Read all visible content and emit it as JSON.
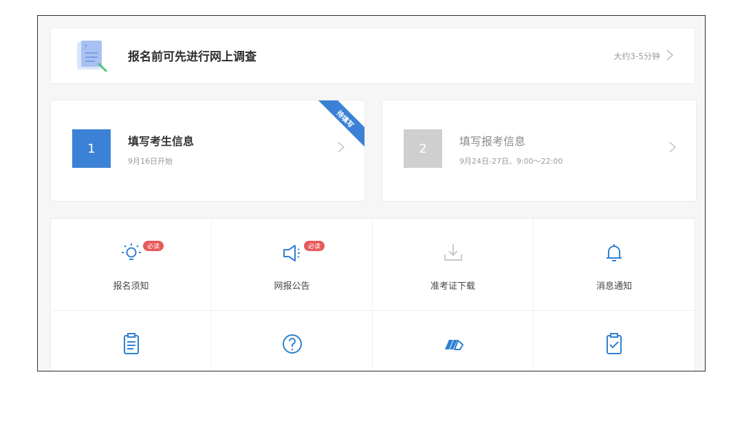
{
  "survey": {
    "title": "报名前可先进行网上调查",
    "meta": "大约3-5分钟"
  },
  "steps": [
    {
      "number": "1",
      "title": "填写考生信息",
      "subtitle": "9月16日开始",
      "ribbon": "待填写"
    },
    {
      "number": "2",
      "title": "填写报考信息",
      "subtitle": "9月24日-27日、9:00～22:00"
    }
  ],
  "grid": {
    "items": [
      {
        "label": "报名须知",
        "badge": "必读",
        "icon": "lightbulb-icon"
      },
      {
        "label": "网报公告",
        "badge": "必读",
        "icon": "megaphone-icon"
      },
      {
        "label": "准考证下载",
        "icon": "download-icon"
      },
      {
        "label": "消息通知",
        "icon": "bell-icon"
      }
    ],
    "row2_icons": [
      "clipboard-list-icon",
      "help-circle-icon",
      "fast-forward-icon",
      "clipboard-check-icon"
    ]
  },
  "colors": {
    "accent": "#3b82d6",
    "disabled": "#cfcfcf",
    "badge": "#e75a5a",
    "icon_blue": "#2f7fd1"
  }
}
